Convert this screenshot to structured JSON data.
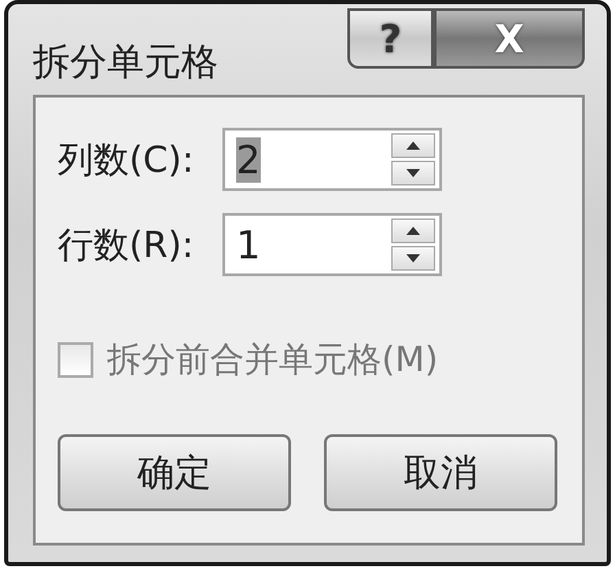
{
  "window": {
    "title": "拆分单元格",
    "help_button": "?",
    "close_button": "X"
  },
  "fields": [
    {
      "label": "列数(C):",
      "value": "2",
      "selected": true
    },
    {
      "label": "行数(R):",
      "value": "1",
      "selected": false
    }
  ],
  "checkbox": {
    "label": "拆分前合并单元格(M)",
    "checked": false,
    "disabled": true
  },
  "buttons": [
    "确定",
    "取消"
  ]
}
